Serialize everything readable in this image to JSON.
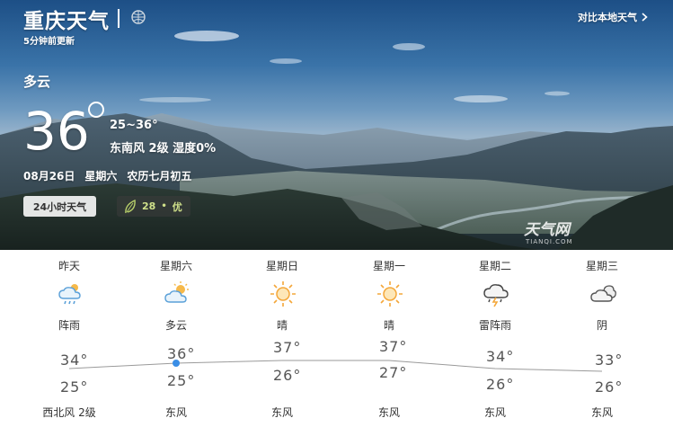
{
  "header": {
    "city": "重庆天气",
    "updated": "5分钟前更新",
    "compare_link": "对比本地天气"
  },
  "current": {
    "condition": "多云",
    "temperature": "36",
    "range": "25~36°",
    "wind_humidity": "东南风 2级 湿度0%",
    "date": "08月26日",
    "weekday": "星期六",
    "lunar": "农历七月初五",
    "hourly_button": "24小时天气",
    "aqi_value": "28",
    "aqi_level": "优",
    "aqi_color": "#cfe08a"
  },
  "watermark": {
    "brand": "天气网",
    "domain": "TIANQI.COM"
  },
  "forecast": {
    "days": [
      {
        "name": "昨天",
        "icon": "rain-shower-icon",
        "condition": "阵雨",
        "high": "34°",
        "low": "25°",
        "wind": "西北风 2级"
      },
      {
        "name": "星期六",
        "icon": "partly-cloudy-icon",
        "condition": "多云",
        "high": "36°",
        "low": "25°",
        "wind": "东风"
      },
      {
        "name": "星期日",
        "icon": "sunny-icon",
        "condition": "晴",
        "high": "37°",
        "low": "26°",
        "wind": "东风"
      },
      {
        "name": "星期一",
        "icon": "sunny-icon",
        "condition": "晴",
        "high": "37°",
        "low": "27°",
        "wind": "东风"
      },
      {
        "name": "星期二",
        "icon": "thunderstorm-icon",
        "condition": "雷阵雨",
        "high": "34°",
        "low": "26°",
        "wind": "东风"
      },
      {
        "name": "星期三",
        "icon": "overcast-icon",
        "condition": "阴",
        "high": "33°",
        "low": "26°",
        "wind": "东风"
      }
    ],
    "high_values": [
      34,
      36,
      37,
      37,
      34,
      33
    ],
    "today_index": 1,
    "accent": "#3a8ee6"
  }
}
